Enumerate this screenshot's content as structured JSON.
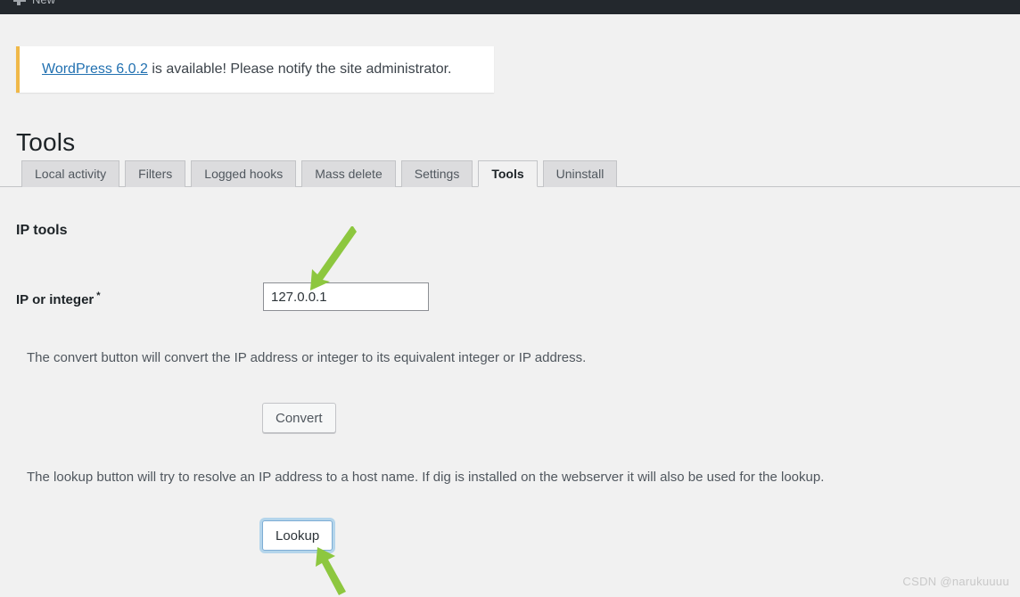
{
  "adminbar": {
    "new_label": "New",
    "new_icon": "plus-icon",
    "background": "#23282d"
  },
  "notice": {
    "link_text": "WordPress 6.0.2",
    "message": " is available! Please notify the site administrator.",
    "accent_color": "#f0b849",
    "link_color": "#2271b1"
  },
  "page": {
    "title": "Tools"
  },
  "tabs": [
    {
      "label": "Local activity",
      "active": false
    },
    {
      "label": "Filters",
      "active": false
    },
    {
      "label": "Logged hooks",
      "active": false
    },
    {
      "label": "Mass delete",
      "active": false
    },
    {
      "label": "Settings",
      "active": false
    },
    {
      "label": "Tools",
      "active": true
    },
    {
      "label": "Uninstall",
      "active": false
    }
  ],
  "section": {
    "heading": "IP tools"
  },
  "form": {
    "field_label": "IP or integer",
    "required_marker": "*",
    "ip_value": "127.0.0.1",
    "ip_placeholder": ""
  },
  "convert": {
    "description": "The convert button will convert the IP address or integer to its equivalent integer or IP address.",
    "button_label": "Convert"
  },
  "lookup": {
    "description": "The lookup button will try to resolve an IP address to a host name. If dig is installed on the webserver it will also be used for the lookup.",
    "button_label": "Lookup",
    "focus_ring_color": "#7eadd4"
  },
  "annotations": {
    "arrow_color": "#8dc73f",
    "arrow_top_target": "ip-input",
    "arrow_bottom_target": "lookup-button"
  },
  "watermark": {
    "text": "CSDN @narukuuuu"
  }
}
